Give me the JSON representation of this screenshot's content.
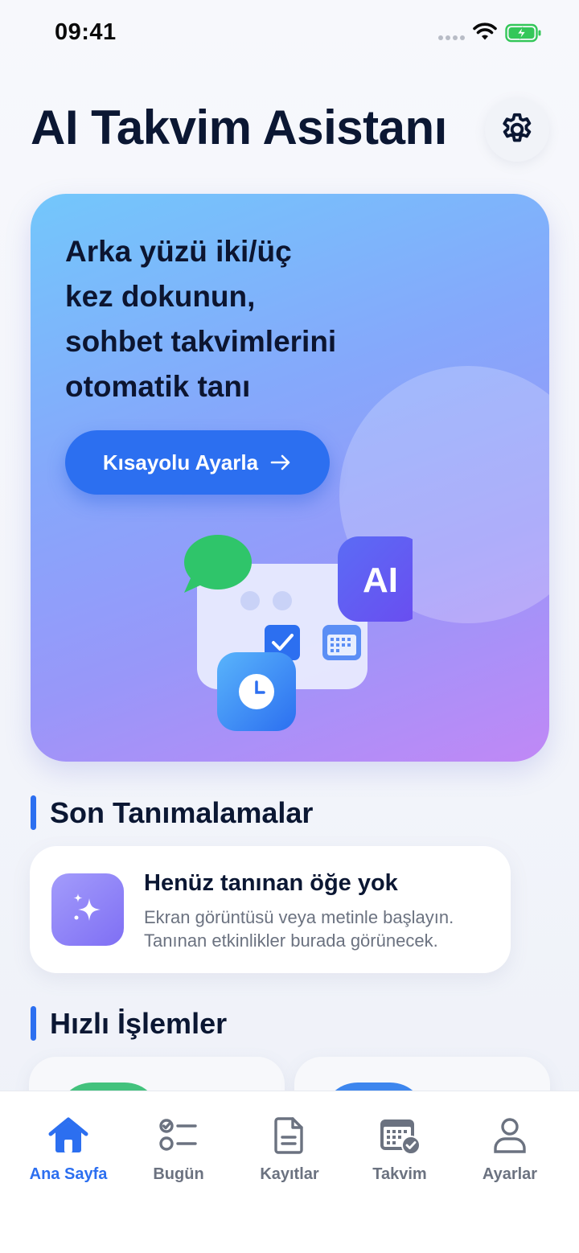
{
  "status_bar": {
    "time": "09:41"
  },
  "header": {
    "title": "AI Takvim Asistanı",
    "settings_icon": "gear-icon"
  },
  "hero": {
    "title_lines": [
      "Arka yüzü iki/üç",
      "kez dokunun,",
      "sohbet takvimlerini",
      "otomatik tanı"
    ],
    "button_label": "Kısayolu Ayarla",
    "ai_badge": "AI"
  },
  "recent": {
    "section_title": "Son Tanımalamalar",
    "empty_title": "Henüz tanınan öğe yok",
    "empty_desc_line1": "Ekran görüntüsü veya metinle başlayın.",
    "empty_desc_line2": "Tanınan etkinlikler burada görünecek."
  },
  "quick": {
    "section_title": "Hızlı İşlemler"
  },
  "tabs": [
    {
      "label": "Ana Sayfa",
      "icon": "home-icon",
      "active": true
    },
    {
      "label": "Bugün",
      "icon": "checklist-icon",
      "active": false
    },
    {
      "label": "Kayıtlar",
      "icon": "document-icon",
      "active": false
    },
    {
      "label": "Takvim",
      "icon": "calendar-check-icon",
      "active": false
    },
    {
      "label": "Ayarlar",
      "icon": "person-icon",
      "active": false
    }
  ],
  "colors": {
    "accent": "#2c6ff0",
    "title": "#0b1733",
    "muted": "#6b7280"
  }
}
